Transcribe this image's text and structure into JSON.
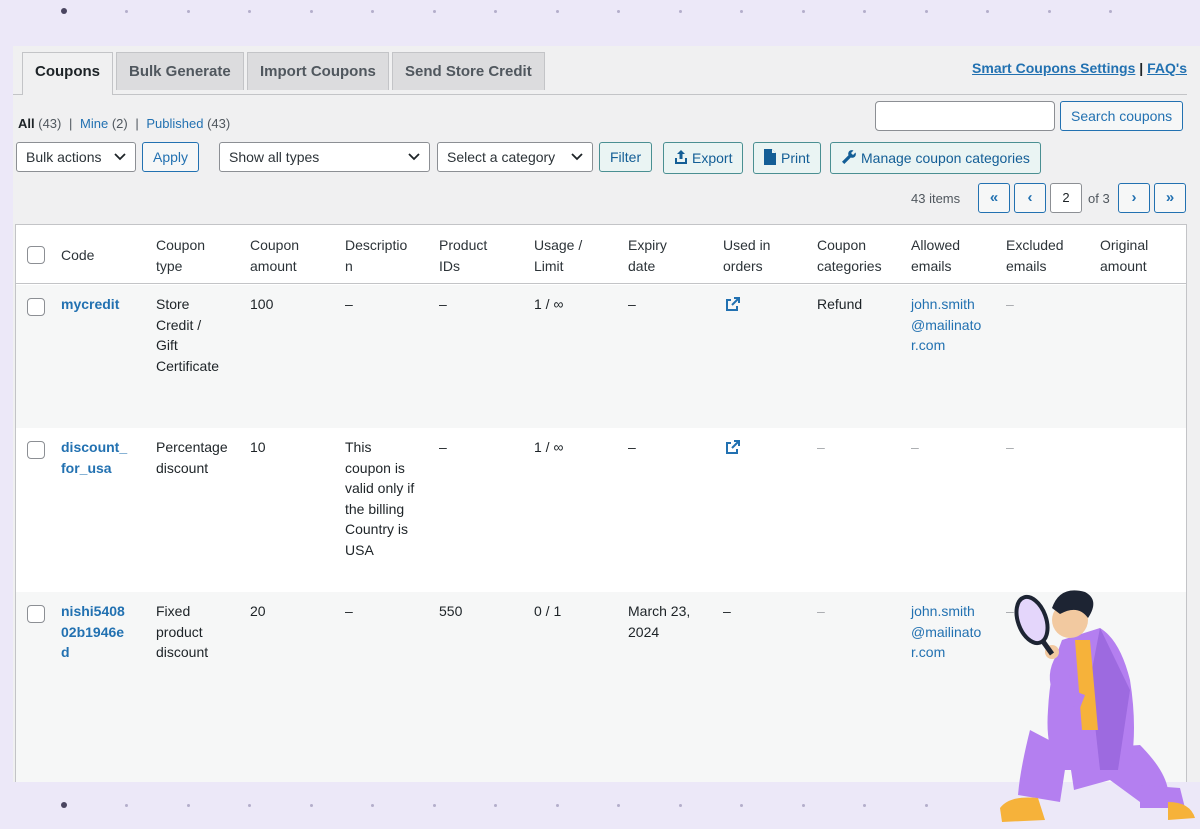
{
  "tabs": [
    {
      "label": "Coupons",
      "active": true
    },
    {
      "label": "Bulk Generate",
      "active": false
    },
    {
      "label": "Import Coupons",
      "active": false
    },
    {
      "label": "Send Store Credit",
      "active": false
    }
  ],
  "top_links": {
    "settings": "Smart Coupons Settings",
    "separator": "|",
    "faq": "FAQ's"
  },
  "views": {
    "all": "All",
    "all_count": "(43)",
    "mine": "Mine",
    "mine_count": "(2)",
    "published": "Published",
    "published_count": "(43)",
    "sep": "|"
  },
  "search": {
    "placeholder": "",
    "button": "Search coupons"
  },
  "filters": {
    "bulk_actions": "Bulk actions",
    "apply": "Apply",
    "types": "Show all types",
    "category": "Select a category",
    "filter": "Filter",
    "export": "Export",
    "print": "Print",
    "manage": "Manage coupon categories"
  },
  "pagination": {
    "items": "43 items",
    "first": "«",
    "prev": "‹",
    "current": "2",
    "of": "of 3",
    "next": "›",
    "last": "»"
  },
  "columns": [
    [
      "Code"
    ],
    [
      "Coupon",
      "type"
    ],
    [
      "Coupon",
      "amount"
    ],
    [
      "Descriptio",
      "n"
    ],
    [
      "Product",
      "IDs"
    ],
    [
      "Usage /",
      "Limit"
    ],
    [
      "Expiry",
      "date"
    ],
    [
      "Used in",
      "orders"
    ],
    [
      "Coupon",
      "categories"
    ],
    [
      "Allowed",
      "emails"
    ],
    [
      "Excluded",
      "emails"
    ],
    [
      "Original",
      "amount"
    ]
  ],
  "rows": [
    {
      "code": [
        "mycredit"
      ],
      "type": [
        "Store",
        "Credit /",
        "Gift",
        "Certificate"
      ],
      "amount": "100",
      "description": [
        "–"
      ],
      "product_ids": "–",
      "usage": "1 / ∞",
      "expiry": [
        "–"
      ],
      "used_in": "external-link-icon",
      "categories": "Refund",
      "allowed": [
        "john.smith",
        "@mailinato",
        "r.com"
      ],
      "excluded": "–",
      "original": ""
    },
    {
      "code": [
        "discount_",
        "for_usa"
      ],
      "type": [
        "Percentage",
        "discount"
      ],
      "amount": "10",
      "description": [
        "This",
        "coupon is",
        "valid only if",
        "the billing",
        "Country is",
        "USA"
      ],
      "product_ids": "–",
      "usage": "1 / ∞",
      "expiry": [
        "–"
      ],
      "used_in": "external-link-icon",
      "categories": "–",
      "allowed": [
        "–"
      ],
      "excluded": "–",
      "original": ""
    },
    {
      "code": [
        "nishi5408",
        "02b1946e",
        "d"
      ],
      "type": [
        "Fixed",
        "product",
        "discount"
      ],
      "amount": "20",
      "description": [
        "–"
      ],
      "product_ids": "550",
      "usage": "0 / 1",
      "expiry": [
        "March 23,",
        "2024"
      ],
      "used_in": "–",
      "categories": "–",
      "allowed": [
        "john.smith",
        "@mailinato",
        "r.com"
      ],
      "excluded": "–",
      "original": ""
    }
  ],
  "colors": {
    "link": "#2271b1",
    "page_bg": "#f0f0f1",
    "accent_teal": "#4a8f92",
    "frame_bg": "#ece8f8",
    "figure_purple": "#b47ff0"
  }
}
